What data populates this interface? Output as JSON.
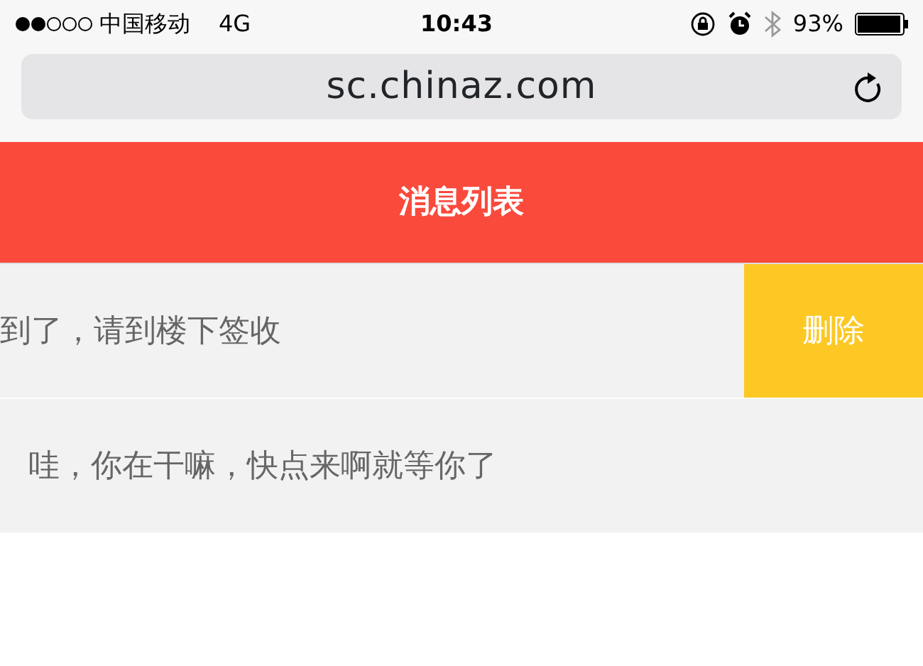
{
  "status_bar": {
    "carrier": "中国移动",
    "network": "4G",
    "time": "10:43",
    "battery": "93%"
  },
  "address_bar": {
    "url": "sc.chinaz.com"
  },
  "header": {
    "title": "消息列表"
  },
  "messages": [
    {
      "text": "到了，请到楼下签收",
      "swiped": true,
      "action": "删除"
    },
    {
      "text": "哇，你在干嘛，快点来啊就等你了",
      "swiped": false
    }
  ]
}
